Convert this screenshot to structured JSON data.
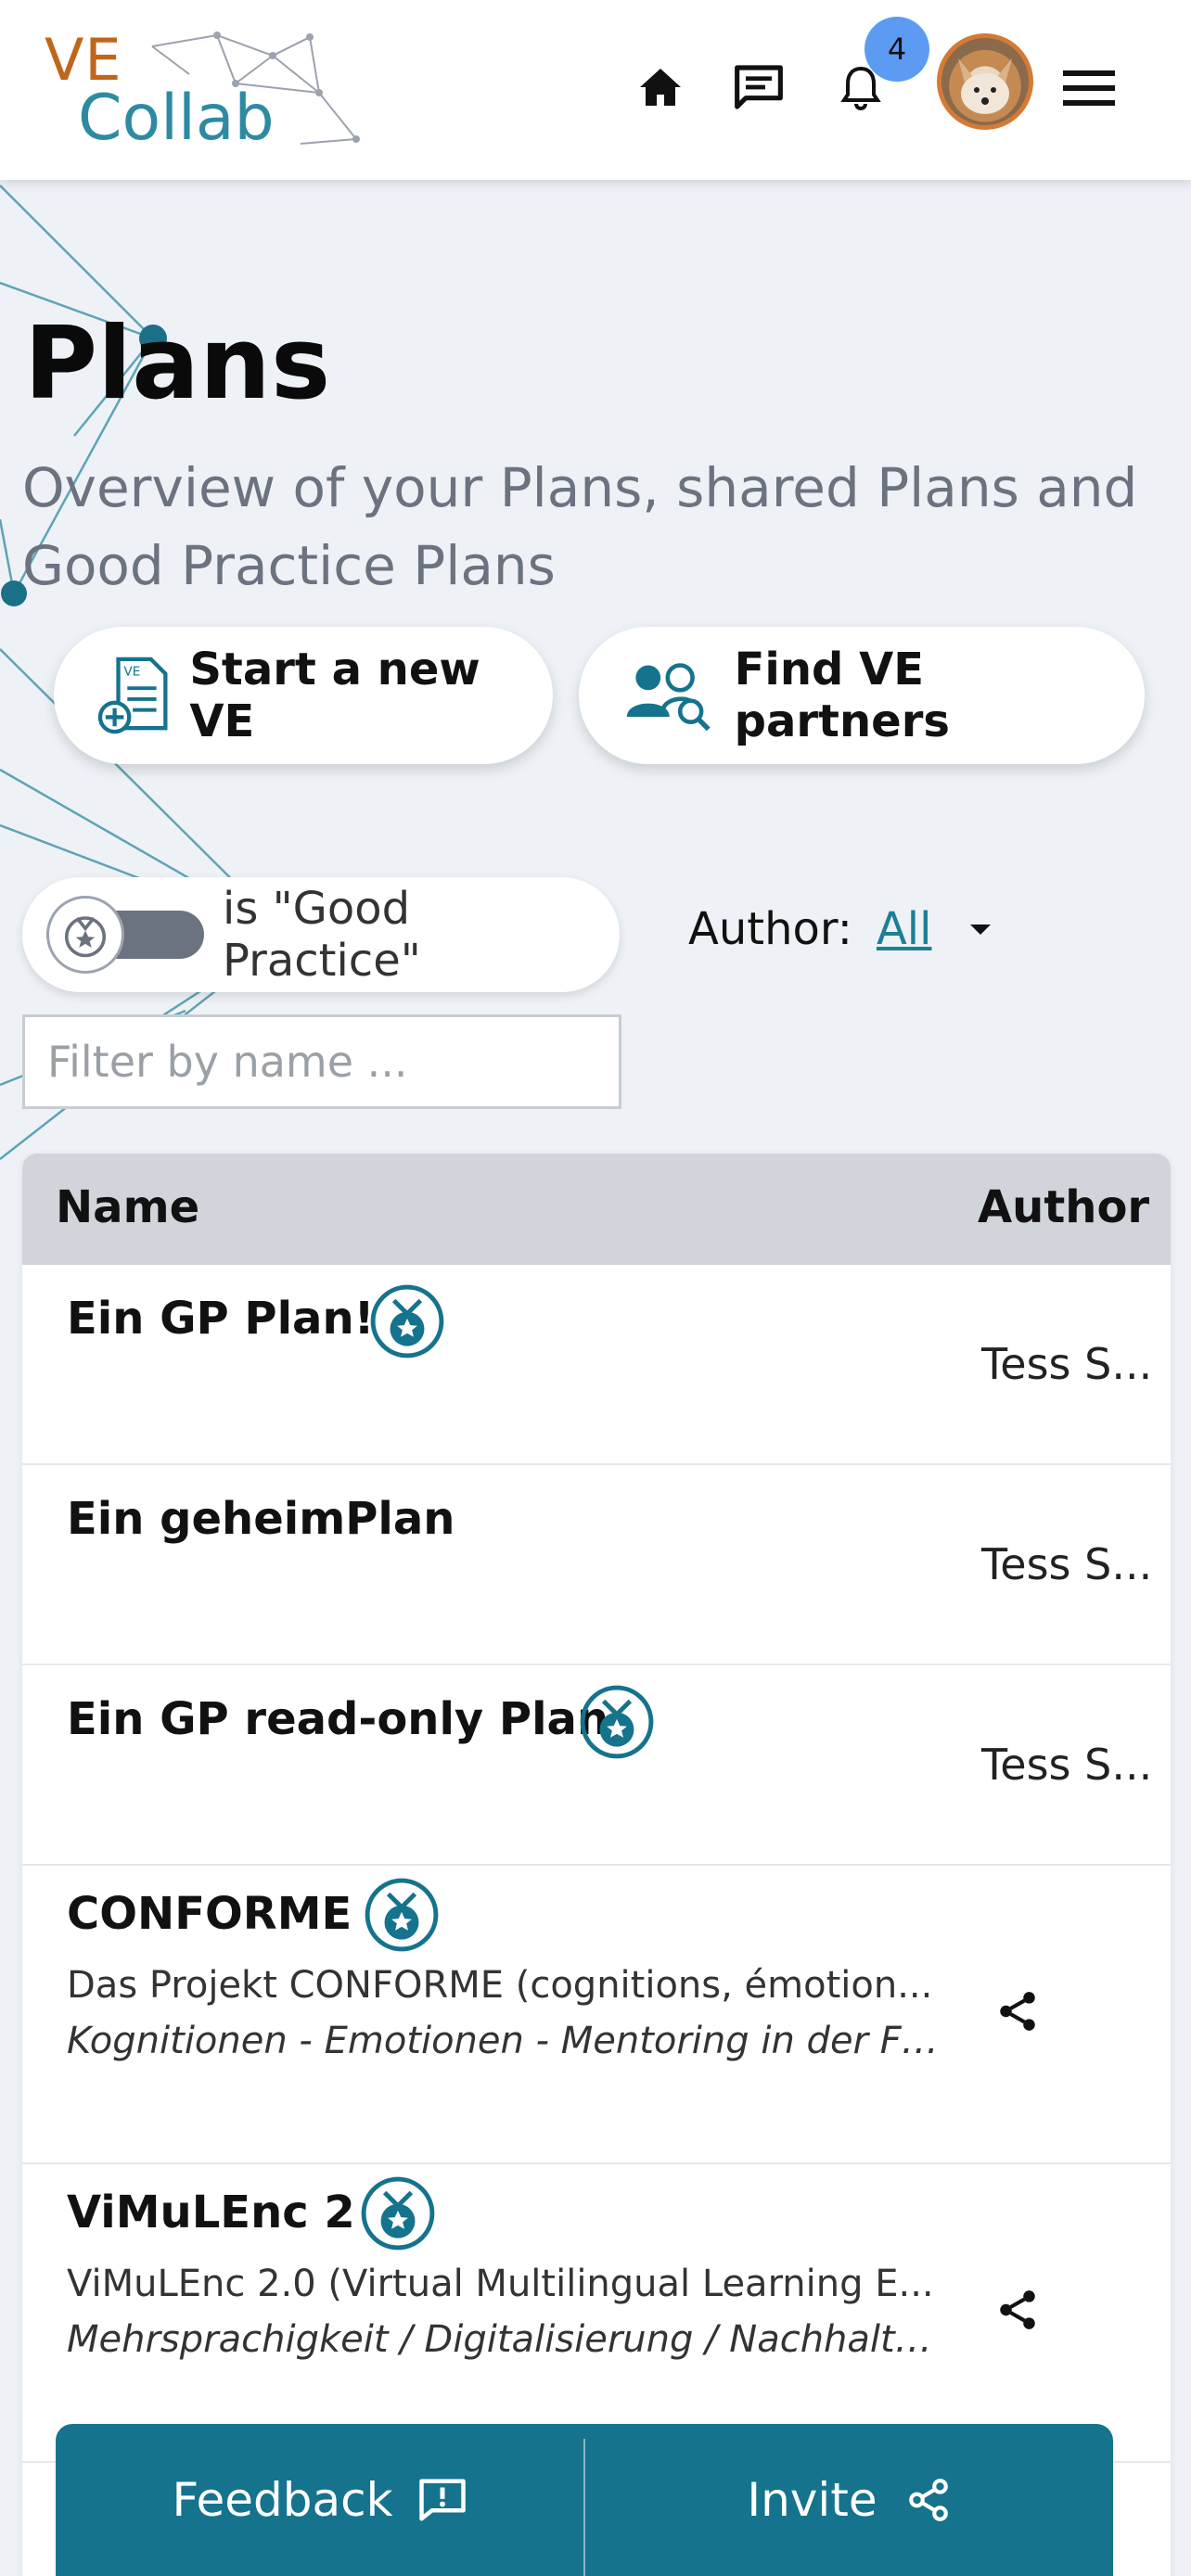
{
  "header": {
    "logo_ve": "VE",
    "logo_collab": "Collab",
    "notification_count": "4",
    "icons": [
      "home-icon",
      "chat-icon",
      "bell-icon",
      "menu-icon"
    ]
  },
  "page": {
    "title": "Plans",
    "subtitle": "Overview of your Plans, shared Plans and Good Practice Plans"
  },
  "actions": {
    "start_ve": "Start a new VE",
    "find_partners": "Find VE partners"
  },
  "filters": {
    "good_practice_label": "is \"Good Practice\"",
    "author_label": "Author:",
    "author_value": "All",
    "name_placeholder": "Filter by name ..."
  },
  "table": {
    "columns": [
      "Name",
      "Author"
    ],
    "rows": [
      {
        "name": "Ein GP Plan!",
        "author": "Tess S...",
        "good_practice": true
      },
      {
        "name": "Ein geheimPlan",
        "author": "Tess S...",
        "good_practice": false
      },
      {
        "name": "Ein GP read-only Plan",
        "author": "Tess S...",
        "good_practice": true
      },
      {
        "name": "CONFORME",
        "description": "Das Projekt CONFORME (cognitions, émotion...",
        "topics": "Kognitionen - Emotionen - Mentoring in der Fre...",
        "good_practice": true,
        "shared": true
      },
      {
        "name": "ViMuLEnc 2",
        "description": "ViMuLEnc 2.0 (Virtual Multilingual Learning E...",
        "topics": "Mehrsprachigkeit / Digitalisierung / Nachhaltig...",
        "good_practice": true,
        "shared": true
      }
    ]
  },
  "bottom_bar": {
    "feedback": "Feedback",
    "invite": "Invite"
  },
  "colors": {
    "accent": "#15738d",
    "logo_orange": "#c0661b",
    "logo_teal": "#2e8aa3",
    "badge": "#5b9cf2",
    "link": "#1b7f96"
  }
}
